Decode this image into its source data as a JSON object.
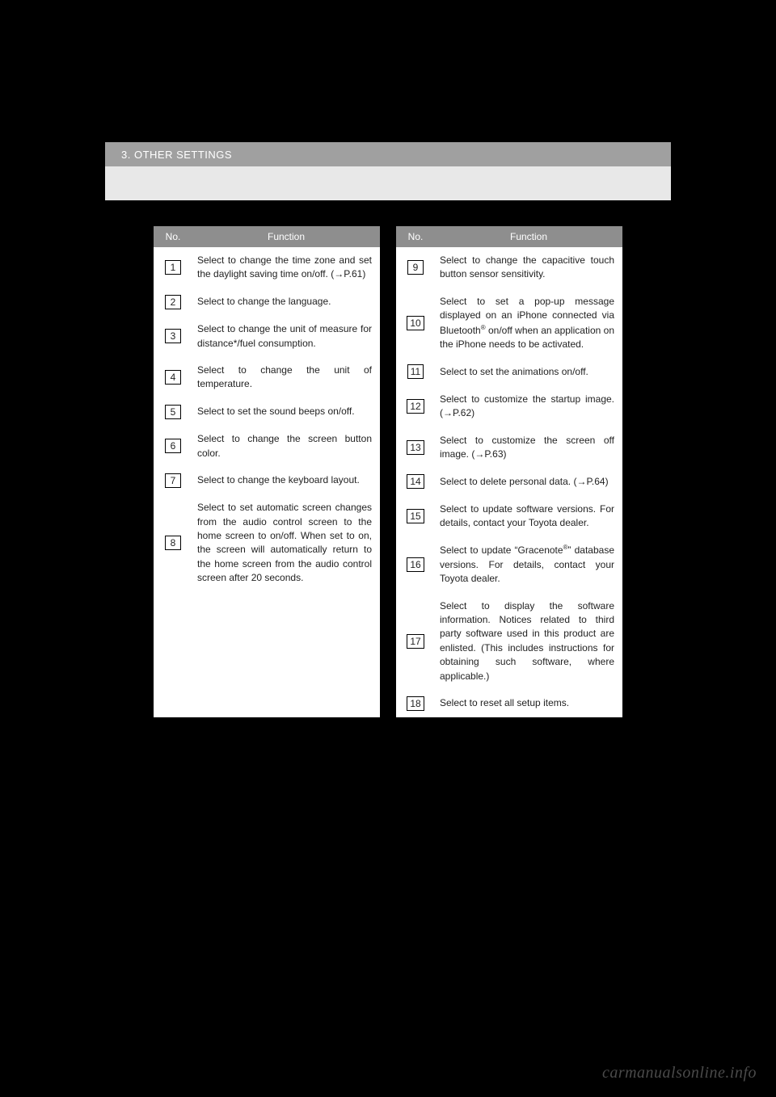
{
  "header": {
    "section_title": "3. OTHER SETTINGS"
  },
  "tables": {
    "left": {
      "headers": {
        "no": "No.",
        "fn": "Function"
      },
      "rows": [
        {
          "n": "1",
          "text": "Select to change the time zone and set the daylight saving time on/off. (→P.61)"
        },
        {
          "n": "2",
          "text": "Select to change the language."
        },
        {
          "n": "3",
          "text": "Select to change the unit of measure for distance*/fuel consumption."
        },
        {
          "n": "4",
          "text": "Select to change the unit of temperature."
        },
        {
          "n": "5",
          "text": "Select to set the sound beeps on/off."
        },
        {
          "n": "6",
          "text": "Select to change the screen button color."
        },
        {
          "n": "7",
          "text": "Select to change the keyboard layout."
        },
        {
          "n": "8",
          "text": "Select to set automatic screen changes from the audio control screen to the home screen to on/off. When set to on, the screen will automatically return to the home screen from the audio control screen after 20 seconds."
        }
      ]
    },
    "right": {
      "headers": {
        "no": "No.",
        "fn": "Function"
      },
      "rows": [
        {
          "n": "9",
          "text": "Select to change the capacitive touch button sensor sensitivity."
        },
        {
          "n": "10",
          "html": "Select to set a pop-up message displayed on an iPhone connected via Bluetooth<span class=\"sup\">®</span> on/off when an application on the iPhone needs to be activated."
        },
        {
          "n": "11",
          "text": "Select to set the animations on/off."
        },
        {
          "n": "12",
          "text": "Select to customize the startup image. (→P.62)"
        },
        {
          "n": "13",
          "text": "Select to customize the screen off image. (→P.63)"
        },
        {
          "n": "14",
          "text": "Select to delete personal data. (→P.64)"
        },
        {
          "n": "15",
          "text": "Select to update software versions. For details, contact your Toyota dealer."
        },
        {
          "n": "16",
          "html": "Select to update “Gracenote<span class=\"sup\">®</span>” database versions. For details, contact your Toyota dealer."
        },
        {
          "n": "17",
          "text": "Select to display the software information. Notices related to third party software used in this product are enlisted. (This includes instructions for obtaining such software, where applicable.)"
        },
        {
          "n": "18",
          "text": "Select to reset all setup items."
        }
      ]
    }
  },
  "watermark": "carmanualsonline.info"
}
